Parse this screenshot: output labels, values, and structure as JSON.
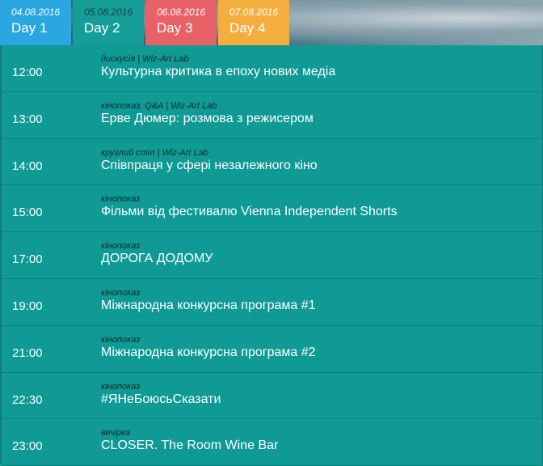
{
  "tabs": [
    {
      "date": "04.08.2016",
      "label": "Day 1"
    },
    {
      "date": "05.08.2016",
      "label": "Day 2"
    },
    {
      "date": "06.08.2016",
      "label": "Day 3"
    },
    {
      "date": "07.08.2016",
      "label": "Day 4"
    }
  ],
  "colors": {
    "day1": "#2aa7e0",
    "day2": "#149d99",
    "day3": "#e86167",
    "day4": "#f4ae3e",
    "background": "#0f9a95"
  },
  "events": [
    {
      "time": "12:00",
      "tag": "дискусія | Wiz-Art Lab",
      "title": "Культурна критика в епоху нових медіа"
    },
    {
      "time": "13:00",
      "tag": "кінопоказ, Q&A | Wiz-Art Lab",
      "title": "Ерве Дюмер: розмова з режисером"
    },
    {
      "time": "14:00",
      "tag": "круглий стіл | Wiz-Art Lab",
      "title": "Співпраця у сфері незалежного кіно"
    },
    {
      "time": "15:00",
      "tag": "кінопоказ",
      "title": "Фільми від фестивалю Vienna Independent Shorts"
    },
    {
      "time": "17:00",
      "tag": "кінопоказ",
      "title": "ДОРОГА ДОДОМУ"
    },
    {
      "time": "19:00",
      "tag": "кінопоказ",
      "title": "Міжнародна конкурсна програма #1"
    },
    {
      "time": "21:00",
      "tag": "кінопоказ",
      "title": "Міжнародна конкурсна програма #2"
    },
    {
      "time": "22:30",
      "tag": "кінопоказ",
      "title": "#ЯНеБоюсьСказати"
    },
    {
      "time": "23:00",
      "tag": "вечірка",
      "title": "CLOSER. The Room Wine Bar"
    }
  ]
}
